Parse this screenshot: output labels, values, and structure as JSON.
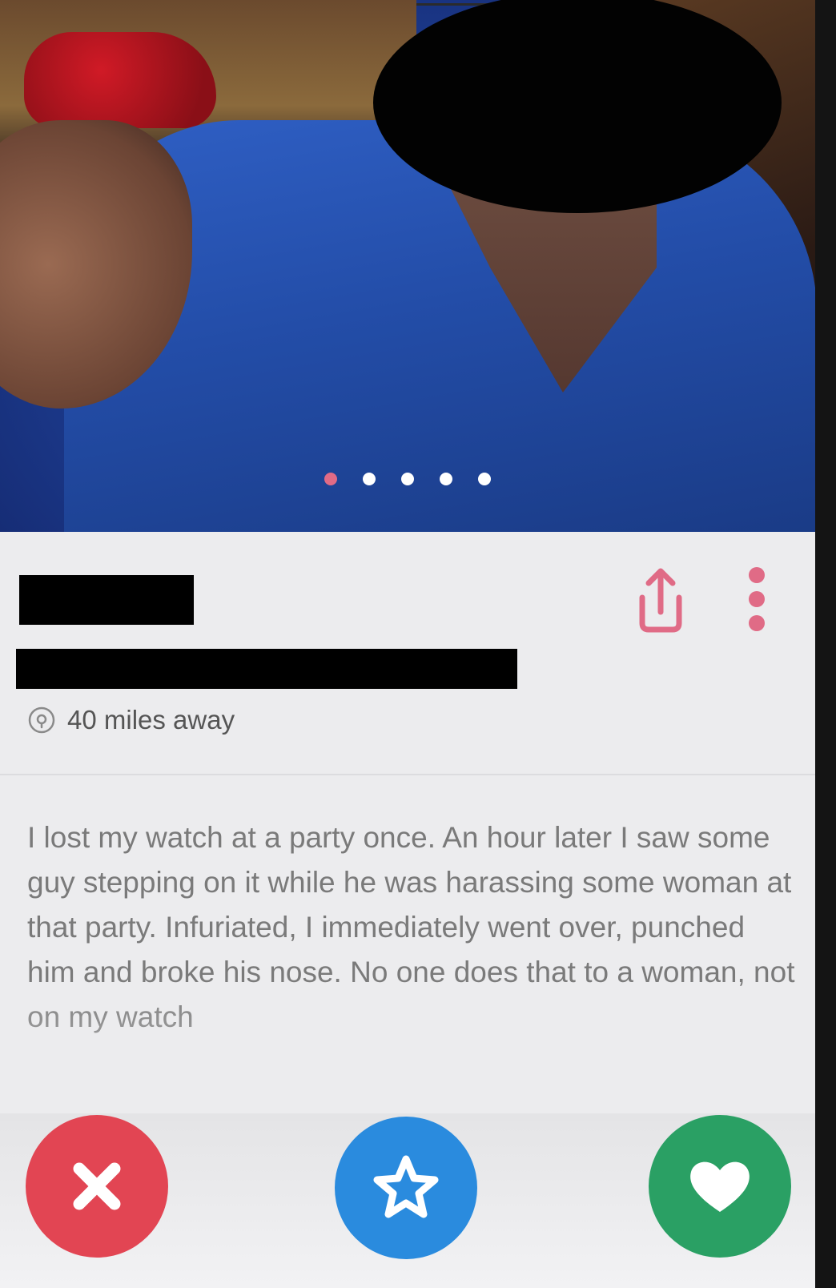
{
  "photo": {
    "dots_total": 5,
    "dot_active_index": 0
  },
  "profile": {
    "distance": "40 miles away",
    "bio": "I lost my watch at a party once. An hour later I saw some guy stepping on it while he was harassing some woman at that party. Infuriated, I immediately went over, punched him and broke his nose. No one does that to a woman, not on my watch"
  },
  "icons": {
    "share": "share-icon",
    "more": "more-vertical-icon",
    "location": "location-pin-icon",
    "nope": "close-icon",
    "super_like": "star-icon",
    "like": "heart-icon"
  },
  "colors": {
    "accent": "#e06b86",
    "nope": "#e24553",
    "super_like": "#2a8bde",
    "like": "#2aa064"
  }
}
